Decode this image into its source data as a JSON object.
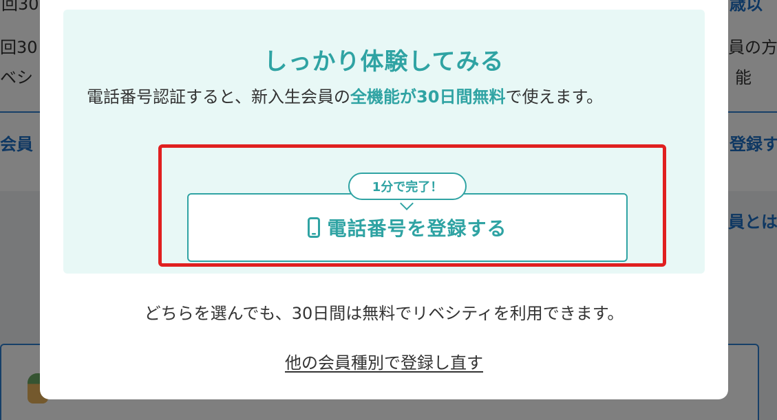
{
  "background": {
    "left_texts": [
      "回30",
      "ベシ",
      "会員"
    ],
    "right_texts": [
      "歳以",
      "員の方",
      "能",
      "登録す",
      "員とは"
    ]
  },
  "modal": {
    "title": "しっかり体験してみる",
    "description_before": "電話番号認証すると、新入生会員の",
    "description_highlight": "全機能が30日間無料",
    "description_after": "で使えます。",
    "badge": "1分で完了！",
    "phone_button_label": "電話番号を登録する",
    "note": "どちらを選んでも、30日間は無料でリベシティを利用できます。",
    "alt_link": "他の会員種別で登録し直す"
  },
  "colors": {
    "accent": "#2fa3a3",
    "highlight_frame": "#e02020",
    "box_background": "#e8f8f6"
  },
  "icons": {
    "phone": "smartphone-icon"
  }
}
